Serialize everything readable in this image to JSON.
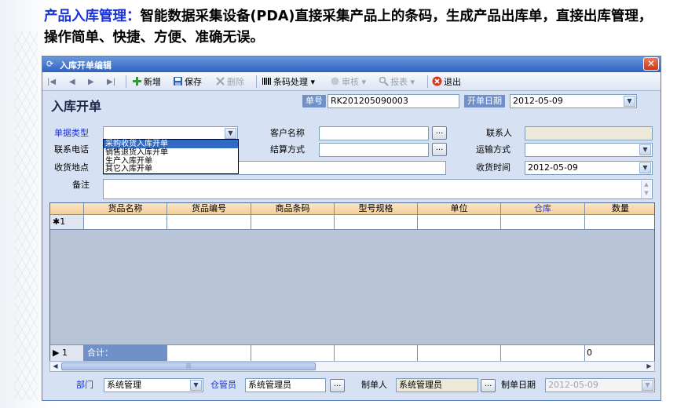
{
  "intro": {
    "highlight": "产品入库管理：",
    "text": "智能数据采集设备(PDA)直接采集产品上的条码，生成产品出库单，直接出库管理，操作简单、快捷、方便、准确无误。"
  },
  "window": {
    "title": "入库开单编辑",
    "close_icon": "close-icon"
  },
  "toolbar": {
    "nav_first": "|◀",
    "nav_prev": "◀",
    "nav_next": "▶",
    "nav_last": "▶|",
    "add": "新增",
    "save": "保存",
    "delete": "删除",
    "barcode": "条码处理",
    "audit": "审核",
    "report": "报表",
    "exit": "退出"
  },
  "form": {
    "title": "入库开单",
    "doc_no_label": "单号",
    "doc_no_value": "RK201205090003",
    "open_date_label": "开单日期",
    "open_date_value": "2012-05-09",
    "doc_type_label": "单据类型",
    "doc_type_value": "",
    "customer_label": "客户名称",
    "customer_value": "",
    "contact_label": "联系人",
    "contact_value": "",
    "phone_label": "联系电话",
    "settle_label": "结算方式",
    "settle_value": "",
    "transport_label": "运输方式",
    "transport_value": "",
    "address_label": "收货地点",
    "address_value": "",
    "receive_time_label": "收货时间",
    "receive_time_value": "2012-05-09",
    "remark_label": "备注",
    "remark_value": "",
    "browse": "..."
  },
  "doc_type_options": [
    "采购收货入库开单",
    "销售退货入库开单",
    "生产入库开单",
    "其它入库开单"
  ],
  "grid": {
    "columns": [
      "货品名称",
      "货品编号",
      "商品条码",
      "型号规格",
      "单位",
      "仓库",
      "数量"
    ],
    "new_row_marker": "✱1",
    "sum_row_marker": "▶ 1",
    "sum_label": "合计：",
    "sum_quantity": "0"
  },
  "footer": {
    "dept_label": "部门",
    "dept_value": "系统管理",
    "keeper_label": "仓管员",
    "keeper_value": "系统管理员",
    "maker_label": "制单人",
    "maker_value": "系统管理员",
    "make_date_label": "制单日期",
    "make_date_value": "2012-05-09"
  },
  "colors": {
    "accent": "#1a33d6",
    "titlebar": "#2f62c0",
    "header": "#f3cf97",
    "window_bg": "#d6e2f3"
  }
}
